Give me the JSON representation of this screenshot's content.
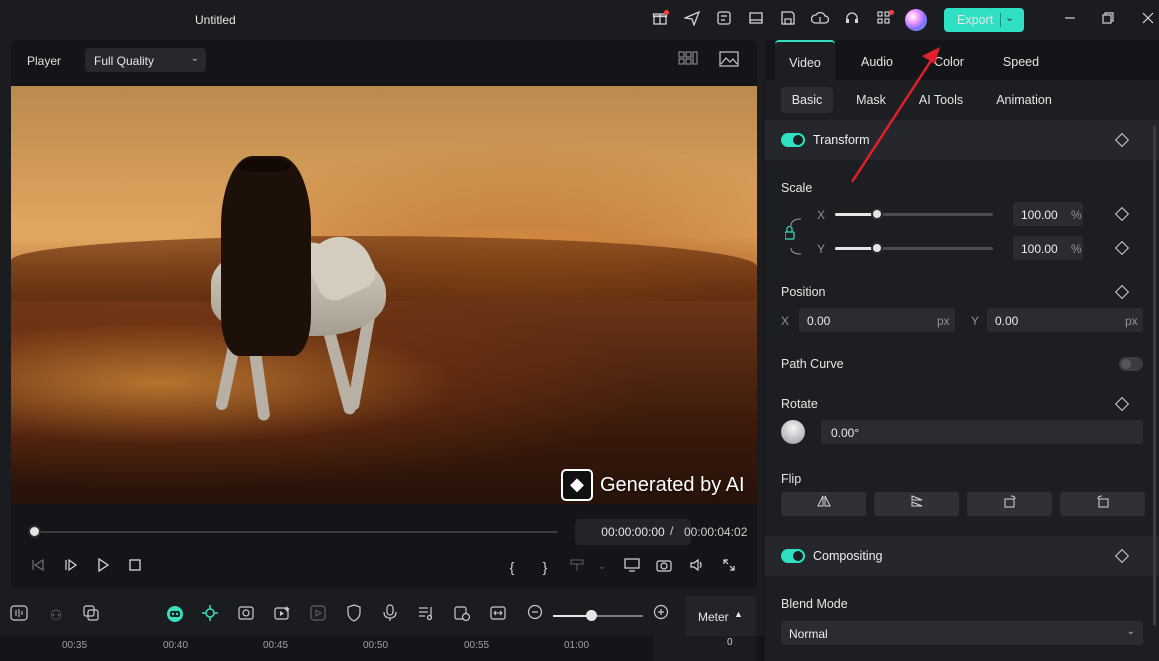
{
  "titlebar": {
    "title": "Untitled",
    "icons": [
      "gift-icon",
      "send-icon",
      "template-icon",
      "layout-icon",
      "save-icon",
      "cloud-upload-icon",
      "headset-icon",
      "apps-icon"
    ],
    "export_label": "Export",
    "window_controls": [
      "minimize-icon",
      "restore-icon",
      "close-icon"
    ]
  },
  "player": {
    "label": "Player",
    "quality": "Full Quality",
    "watermark": "Generated by AI",
    "current_time": "00:00:00:00",
    "separator": "/",
    "total_time": "00:00:04:02",
    "progress": 0
  },
  "timeline": {
    "meter_label": "Meter",
    "ruler_ticks": [
      "00:35",
      "00:40",
      "00:45",
      "00:50",
      "00:55",
      "01:00"
    ],
    "meter_zero": "0",
    "zoom_level": 0.43
  },
  "props": {
    "tabs": [
      "Video",
      "Audio",
      "Color",
      "Speed"
    ],
    "active_tab": "Video",
    "subtabs": [
      "Basic",
      "Mask",
      "AI Tools",
      "Animation"
    ],
    "active_subtab": "Basic",
    "transform": {
      "title": "Transform",
      "enabled": true,
      "scale_label": "Scale",
      "x_axis": "X",
      "y_axis": "Y",
      "scale_x": "100.00",
      "scale_y": "100.00",
      "percent": "%",
      "position_label": "Position",
      "pos_x": "0.00",
      "pos_y": "0.00",
      "px": "px",
      "path_curve_label": "Path Curve",
      "path_curve_enabled": false,
      "rotate_label": "Rotate",
      "rotate_value": "0.00°",
      "flip_label": "Flip"
    },
    "compositing": {
      "title": "Compositing",
      "enabled": true,
      "blend_mode_label": "Blend Mode",
      "blend_mode": "Normal"
    }
  },
  "colors": {
    "accent": "#2fe0c2",
    "annotation_arrow": "#e0202a"
  }
}
